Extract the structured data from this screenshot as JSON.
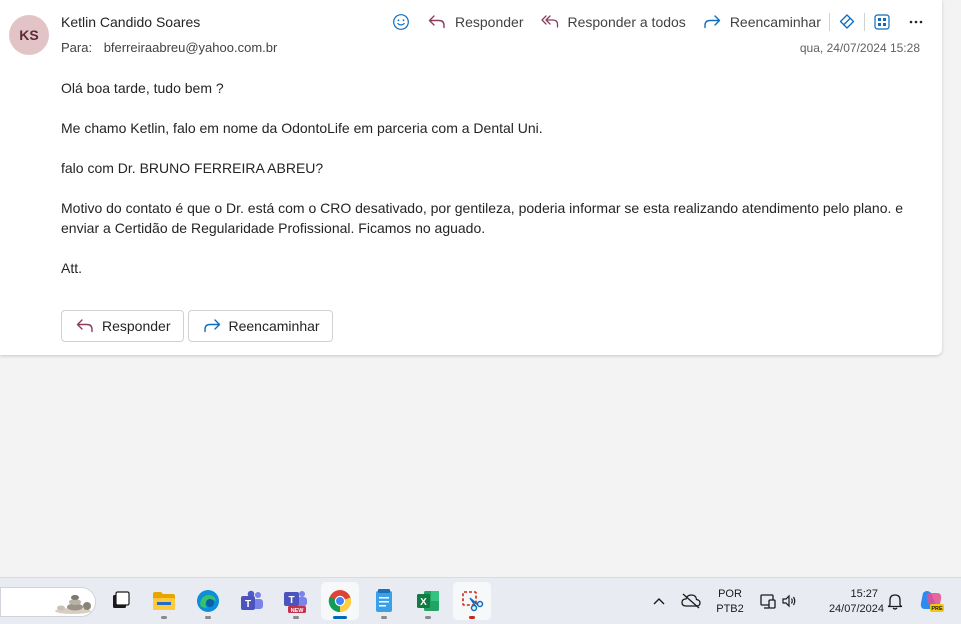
{
  "email": {
    "avatar_initials": "KS",
    "sender_name": "Ketlin Candido Soares",
    "to_label": "Para:",
    "to_address": "bferreiraabreu@yahoo.com.br",
    "timestamp": "qua, 24/07/2024 15:28",
    "body": [
      "Olá boa tarde, tudo bem ?",
      "Me chamo Ketlin, falo em nome da OdontoLife em parceria com a Dental Uni.",
      "falo com Dr. BRUNO FERREIRA ABREU?",
      "Motivo do contato é que o Dr. está com o CRO desativado, por gentileza, poderia informar se esta realizando atendimento pelo plano. e enviar a Certidão de Regularidade Profissional. Ficamos no aguado.",
      "Att."
    ]
  },
  "toolbar": {
    "reply_label": "Responder",
    "reply_all_label": "Responder a todos",
    "forward_label": "Reencaminhar",
    "icons": [
      "emoji-icon",
      "reply-icon",
      "reply-all-icon",
      "forward-icon",
      "copilot-icon",
      "apps-icon",
      "more-icon"
    ]
  },
  "bottom_actions": {
    "reply_label": "Responder",
    "forward_label": "Reencaminhar"
  },
  "taskbar": {
    "apps": [
      "file-explorer",
      "edge",
      "teams",
      "teams-new",
      "chrome",
      "notepad",
      "excel",
      "snipping-tool"
    ],
    "lang_line1": "POR",
    "lang_line2": "PTB2",
    "time": "15:27",
    "date": "24/07/2024",
    "new_badge": "NEW",
    "pre_badge": "PRE"
  },
  "colors": {
    "accent_purple": "#8a3b5e",
    "avatar_bg": "#e3c4c6",
    "link_blue": "#0f6cbd"
  }
}
